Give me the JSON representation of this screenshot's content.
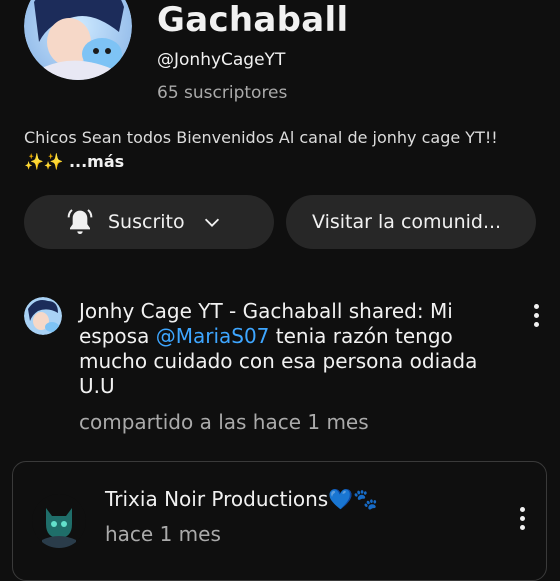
{
  "channel": {
    "title": "Gachaball",
    "handle": "@JonhyCageYT",
    "subscribers": "65 suscriptores",
    "description": "Chicos Sean todos Bienvenidos Al canal de jonhy cage YT!!",
    "description_emoji": "✨✨",
    "more_label": "...más"
  },
  "actions": {
    "subscribed_label": "Suscrito",
    "visit_community_label": "Visitar la comunid..."
  },
  "post": {
    "text_before": "Jonhy Cage YT - Gachaball shared: Mi esposa ",
    "mention": "@MariaS07",
    "text_after": " tenia razón tengo mucho cuidado con esa persona odiada U.U",
    "meta": "compartido a las hace 1 mes"
  },
  "shared_post": {
    "author": "Trixia Noir Productions💙🐾",
    "time": "hace 1 mes"
  },
  "colors": {
    "background": "#0f0f0f",
    "pill": "#272727",
    "mention": "#3ea6ff",
    "secondary_text": "#aaaaaa"
  },
  "icons": {
    "bell": "bell-icon",
    "chevron": "chevron-down-icon",
    "more": "more-vert-icon"
  }
}
